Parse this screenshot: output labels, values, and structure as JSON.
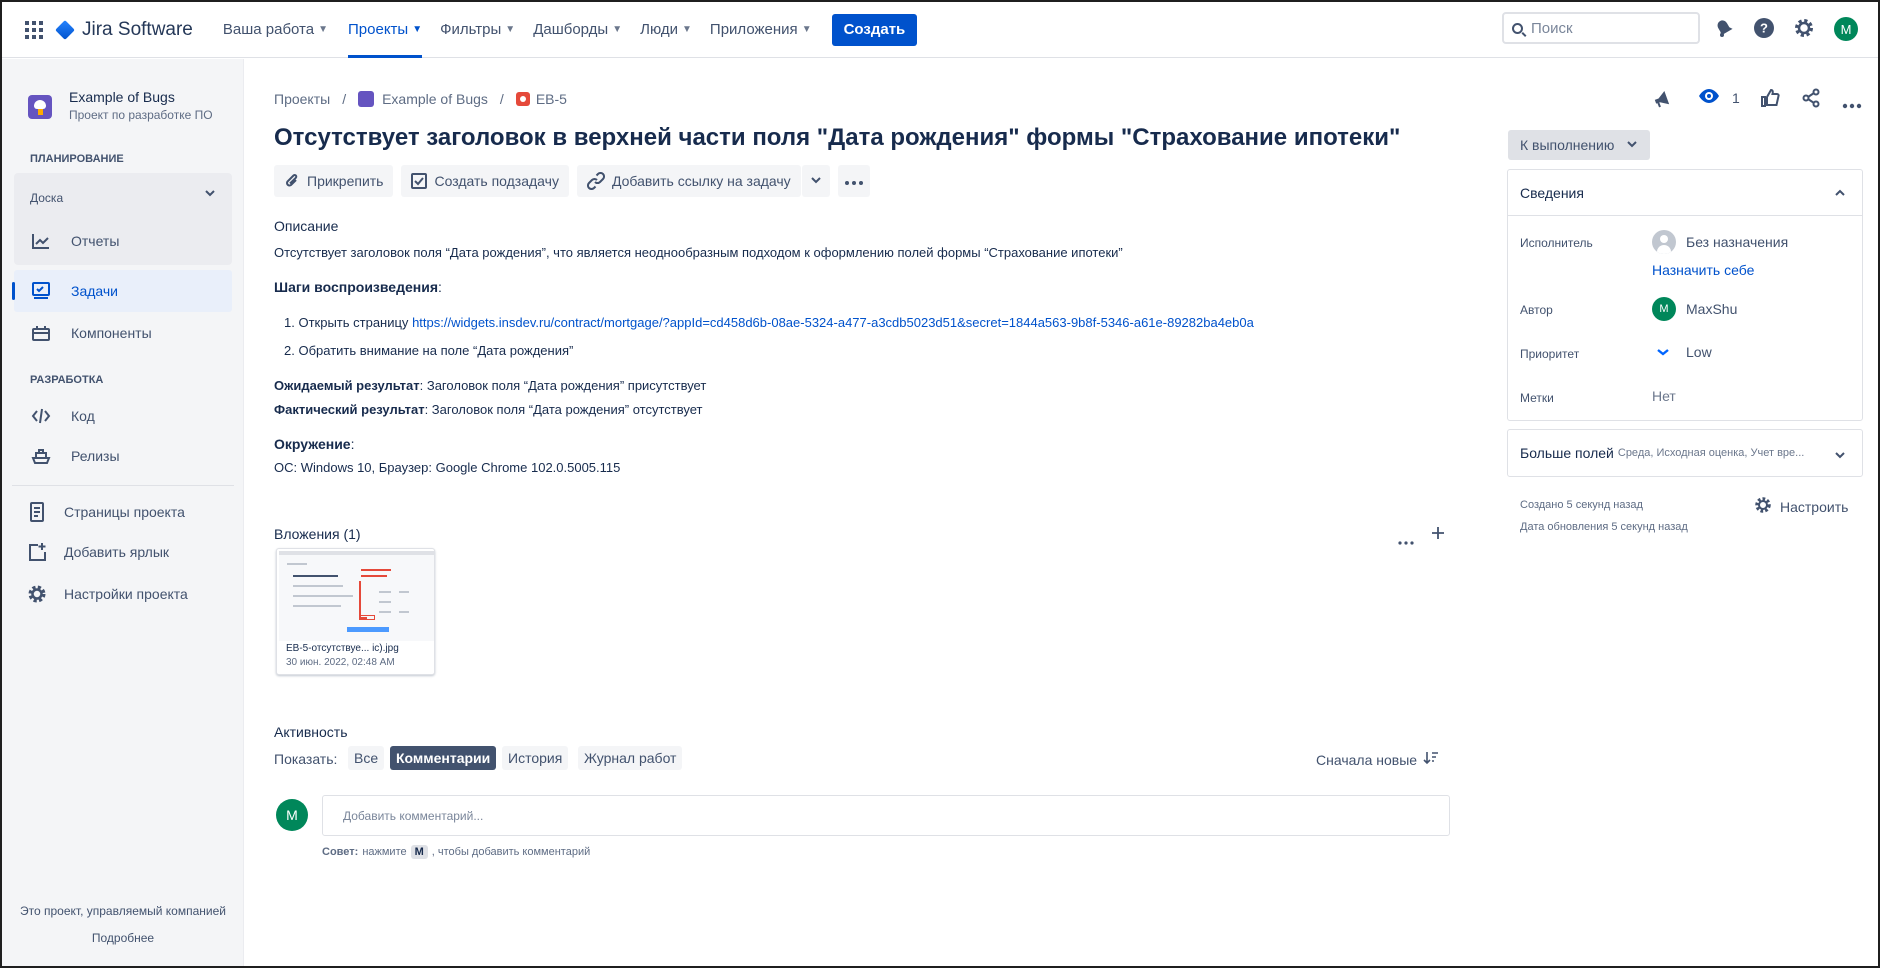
{
  "app": {
    "name": "Jira Software"
  },
  "nav": {
    "items": [
      "Ваша работа",
      "Проекты",
      "Фильтры",
      "Дашборды",
      "Люди",
      "Приложения"
    ],
    "create": "Создать",
    "search_placeholder": "Поиск",
    "avatar": "M"
  },
  "sidebar": {
    "project_name": "Example of Bugs",
    "project_type": "Проект по разработке ПО",
    "planning": "ПЛАНИРОВАНИЕ",
    "board": "Доска",
    "reports": "Отчеты",
    "issues": "Задачи",
    "components": "Компоненты",
    "development": "РАЗРАБОТКА",
    "code": "Код",
    "releases": "Релизы",
    "pages": "Страницы проекта",
    "add_shortcut": "Добавить ярлык",
    "settings": "Настройки проекта",
    "footer": "Это проект, управляемый компанией",
    "learn_more": "Подробнее"
  },
  "breadcrumb": {
    "projects": "Проекты",
    "project": "Example of Bugs",
    "issue": "EB-5"
  },
  "issue": {
    "title": "Отсутствует заголовок в верхней части поля \"Дата рождения\" формы \"Страхование ипотеки\"",
    "toolbar": {
      "attach": "Прикрепить",
      "subtask": "Создать подзадачу",
      "link": "Добавить ссылку на задачу"
    },
    "watchers": "1",
    "description_h": "Описание",
    "description": "Отсутствует заголовок поля “Дата рождения”, что является неоднообразным подходом к оформлению полей формы “Страхование ипотеки”",
    "steps_h": "Шаги воспроизведения",
    "colon": ":",
    "step1_num": "1.",
    "step1_text": "Открыть страницу ",
    "step1_link": "https://widgets.insdev.ru/contract/mortgage/?appId=cd458d6b-08ae-5324-a477-a3cdb5023d51&secret=1844a563-9b8f-5346-a61e-89282ba4eb0a",
    "step2_num": "2.",
    "step2_text": "Обратить внимание на поле “Дата рождения”",
    "expected_label": "Ожидаемый результат",
    "expected_text": ": Заголовок поля “Дата рождения” присутствует",
    "actual_label": "Фактический результат",
    "actual_text": ": Заголовок поля “Дата рождения” отсутствует",
    "env_h": "Окружение",
    "env_text": "ОС: Windows 10, Браузер: Google Chrome 102.0.5005.115"
  },
  "attachments": {
    "title": "Вложения (1)",
    "file_name": "EB-5-отсутствуе... ic).jpg",
    "file_date": "30 июн. 2022, 02:48 AM"
  },
  "activity": {
    "title": "Активность",
    "show": "Показать:",
    "filters": [
      "Все",
      "Комментарии",
      "История",
      "Журнал работ"
    ],
    "sort": "Сначала новые",
    "avatar": "M",
    "comment_placeholder": "Добавить комментарий...",
    "tip_label": "Совет:",
    "tip_press": "нажмите",
    "tip_key": "M",
    "tip_rest": ", чтобы добавить комментарий"
  },
  "details": {
    "status": "К выполнению",
    "header": "Сведения",
    "assignee_label": "Исполнитель",
    "assignee": "Без назначения",
    "assign_me": "Назначить себе",
    "reporter_label": "Автор",
    "reporter_avatar": "M",
    "reporter": "MaxShu",
    "priority_label": "Приоритет",
    "priority": "Low",
    "labels_label": "Метки",
    "labels": "Нет",
    "more_fields": "Больше полей",
    "more_fields_hint": "Среда, Исходная оценка, Учет вре...",
    "created": "Создано 5 секунд назад",
    "updated": "Дата обновления 5 секунд назад",
    "configure": "Настроить"
  }
}
